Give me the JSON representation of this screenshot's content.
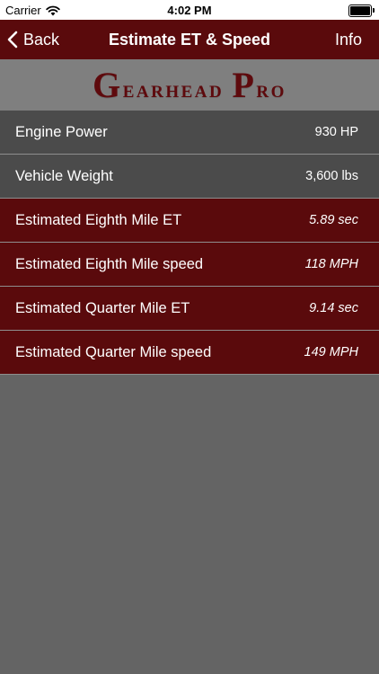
{
  "status_bar": {
    "carrier": "Carrier",
    "time": "4:02 PM",
    "icons": [
      "wifi-icon",
      "battery-icon"
    ]
  },
  "nav": {
    "back_label": "Back",
    "title": "Estimate ET & Speed",
    "info_label": "Info",
    "color": "#5a0a0c"
  },
  "brand": {
    "logo_text": "Gearhead Pro",
    "logo_color": "#5e0a0d"
  },
  "inputs": [
    {
      "label": "Engine Power",
      "value": "930 HP"
    },
    {
      "label": "Vehicle Weight",
      "value": "3,600 lbs"
    }
  ],
  "results": [
    {
      "label": "Estimated Eighth Mile ET",
      "value": "5.89 sec"
    },
    {
      "label": "Estimated Eighth Mile speed",
      "value": "118 MPH"
    },
    {
      "label": "Estimated Quarter Mile ET",
      "value": "9.14 sec"
    },
    {
      "label": "Estimated Quarter Mile speed",
      "value": "149 MPH"
    }
  ]
}
